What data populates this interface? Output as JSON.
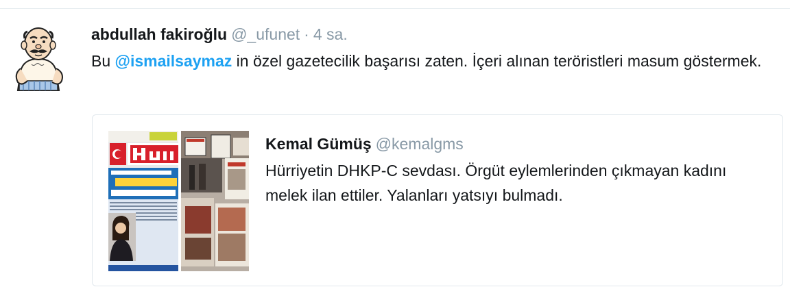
{
  "tweet": {
    "author_name": "abdullah fakiroğlu",
    "author_handle": "@_ufunet",
    "separator": "·",
    "timestamp": "4 sa.",
    "text_before": "Bu ",
    "mention": "@ismailsaymaz",
    "text_after": " in özel gazetecilik başarısı zaten. İçeri alınan teröristleri masum göstermek."
  },
  "quote": {
    "author_name": "Kemal Gümüş",
    "author_handle": "@kemalgms",
    "text": "Hürriyetin DHKP-C sevdası. Örgüt eylemlerinden çıkmayan kadını melek ilan ettiler. Yalanları yatsıyı bulmadı."
  },
  "colors": {
    "mention": "#1da1f2",
    "secondary_text": "#8899a6",
    "primary_text": "#14171a",
    "border": "#e1e8ed",
    "newspaper_red": "#d8202b"
  },
  "icons": {
    "avatar": "cartoon-man-avatar",
    "thumbnail": "newspaper-photo-thumbnail"
  }
}
